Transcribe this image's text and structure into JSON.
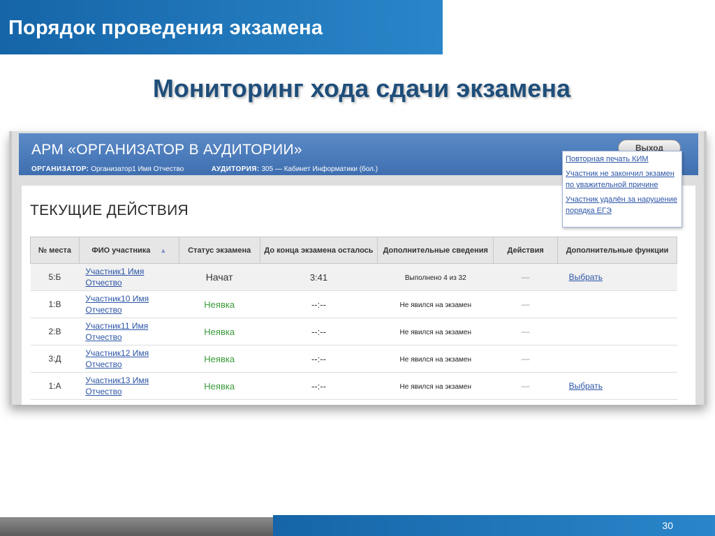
{
  "slide": {
    "header": "Порядок проведения экзамена",
    "title": "Мониторинг хода сдачи экзамена",
    "page_number": "30"
  },
  "app": {
    "title": "АРМ «ОРГАНИЗАТОР В АУДИТОРИИ»",
    "organizer_label": "ОРГАНИЗАТОР:",
    "organizer_value": "Организатор1 Имя Отчество",
    "room_label": "АУДИТОРИЯ:",
    "room_value": "305 — Кабинет Информатики (бол.)",
    "logout_label": "Выход"
  },
  "section": {
    "title": "ТЕКУЩИЕ ДЕЙСТВИЯ"
  },
  "table": {
    "columns": [
      "№ места",
      "ФИО участника",
      "Статус экзамена",
      "До конца экзамена осталось",
      "Дополнительные сведения",
      "Действия",
      "Дополнительные функции"
    ],
    "rows": [
      {
        "seat": "5:Б",
        "name_line1": "Участник1 Имя",
        "name_line2": "Отчество",
        "status": "Начат",
        "remaining": "3:41",
        "info": "Выполнено 4 из 32",
        "action": "—",
        "function": "Выбрать"
      },
      {
        "seat": "1:В",
        "name_line1": "Участник10 Имя",
        "name_line2": "Отчество",
        "status": "Неявка",
        "remaining": "--:--",
        "info": "Не явился на экзамен",
        "action": "—",
        "function": ""
      },
      {
        "seat": "2:В",
        "name_line1": "Участник11 Имя",
        "name_line2": "Отчество",
        "status": "Неявка",
        "remaining": "--:--",
        "info": "Не явился на экзамен",
        "action": "—",
        "function": ""
      },
      {
        "seat": "3:Д",
        "name_line1": "Участник12 Имя",
        "name_line2": "Отчество",
        "status": "Неявка",
        "remaining": "--:--",
        "info": "Не явился на экзамен",
        "action": "—",
        "function": ""
      },
      {
        "seat": "1:А",
        "name_line1": "Участник13 Имя",
        "name_line2": "Отчество",
        "status": "Неявка",
        "remaining": "--:--",
        "info": "Не явился на экзамен",
        "action": "—",
        "function": "Выбрать"
      }
    ]
  },
  "popup": {
    "items": [
      "Повторная печать КИМ",
      "Участник не закончил экзамен по уважительной причине",
      "Участник удалён за нарушение порядка ЕГЭ"
    ]
  }
}
